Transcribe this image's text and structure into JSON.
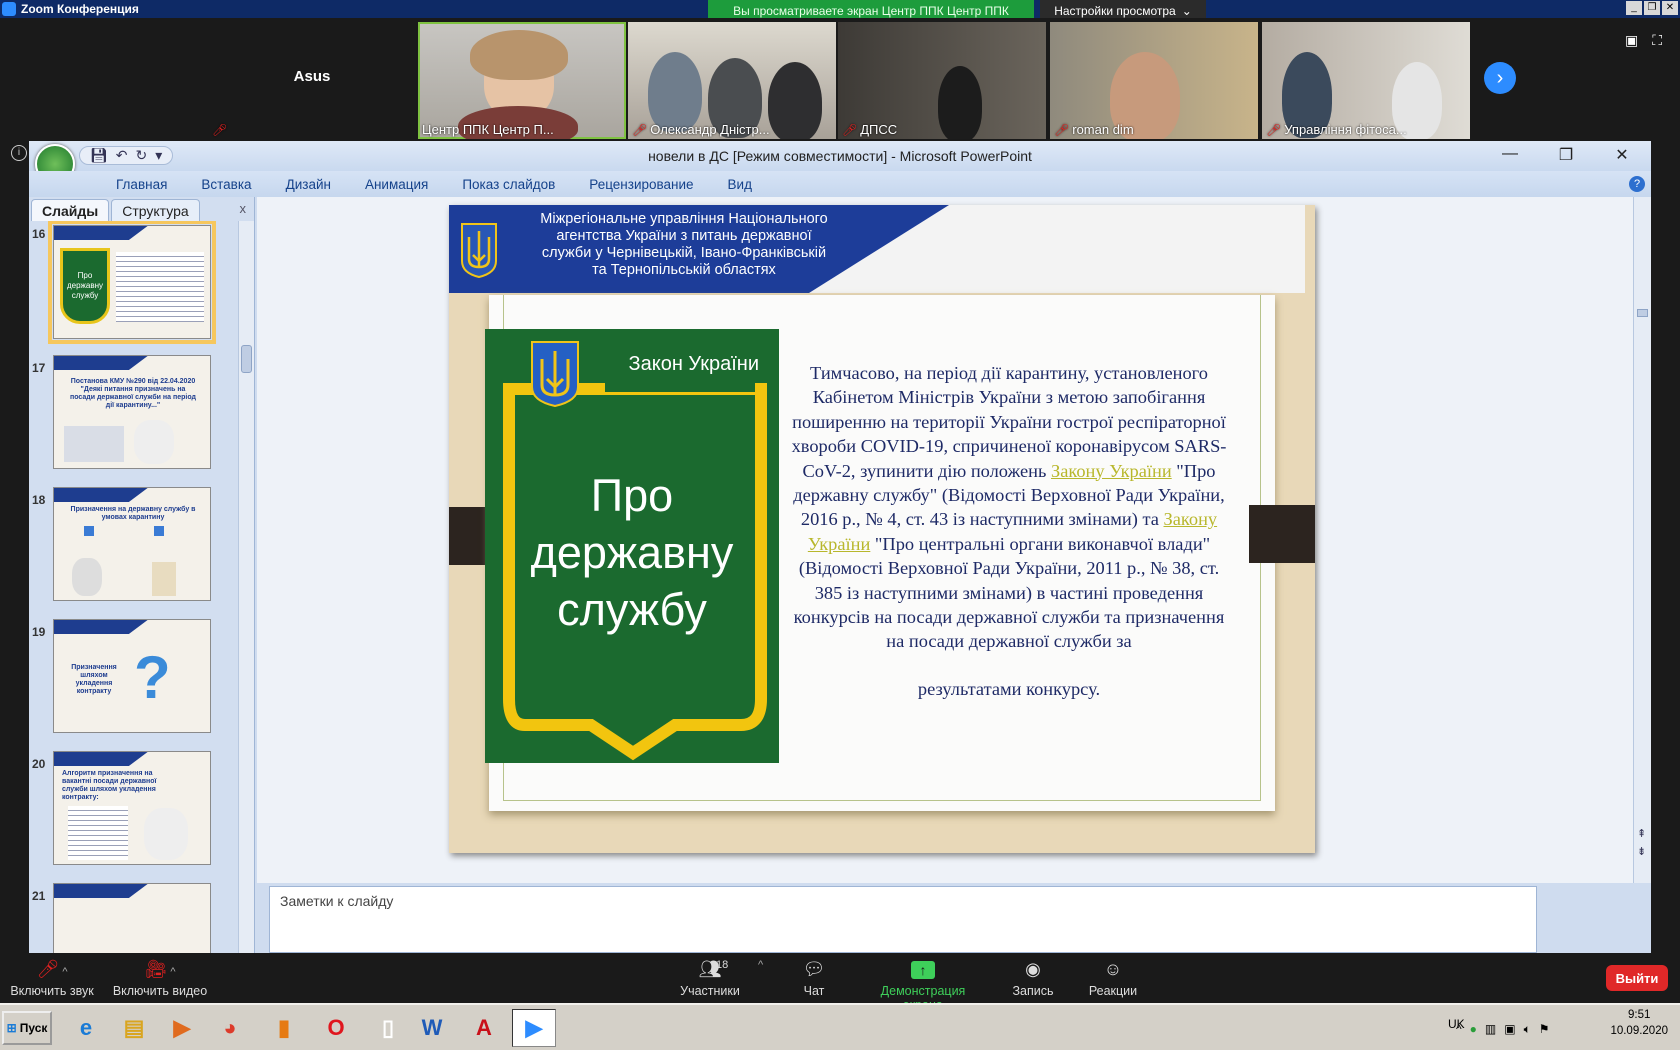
{
  "zoom": {
    "window_title": "Zoom Конференция",
    "share_banner": "Вы просматриваете экран Центр ППК Центр ППК",
    "view_options": "Настройки просмотра",
    "view_options_icon": "chevron-down-icon",
    "participants": [
      {
        "name": "Asus",
        "muted": true,
        "video": false
      },
      {
        "name": "Центр ППК Центр П...",
        "muted": false,
        "video": true
      },
      {
        "name": "Олександр Дністр...",
        "muted": true,
        "video": true
      },
      {
        "name": "ДПСС",
        "muted": true,
        "video": true
      },
      {
        "name": "roman dim",
        "muted": true,
        "video": true
      },
      {
        "name": "Управління фітоса...",
        "muted": true,
        "video": true
      }
    ],
    "toolbar": {
      "mute": "Включить звук",
      "video": "Включить видео",
      "participants": "Участники",
      "participants_count": "18",
      "chat": "Чат",
      "share": "Демонстрация экрана",
      "record": "Запись",
      "reactions": "Реакции",
      "leave": "Выйти"
    },
    "colors": {
      "share_green": "#1d9c3c",
      "leave_red": "#e02828",
      "accent_blue": "#2d8cff"
    }
  },
  "powerpoint": {
    "title": "новели в ДС [Режим совместимости] - Microsoft PowerPoint",
    "ribbon_tabs": [
      "Главная",
      "Вставка",
      "Дизайн",
      "Анимация",
      "Показ слайдов",
      "Рецензирование",
      "Вид"
    ],
    "pane_tabs": [
      "Слайды",
      "Структура"
    ],
    "pane_close": "x",
    "thumbnails": [
      {
        "num": "16",
        "text": "Про державну службу",
        "selected": true
      },
      {
        "num": "17",
        "text": "Постанова КМУ №290 від 22.04.2020 \"Деякі питання призначень на посади державної служби на період дії карантину...\"",
        "selected": false
      },
      {
        "num": "18",
        "text": "Призначення на державну службу в умовах карантину",
        "selected": false
      },
      {
        "num": "19",
        "text": "Призначення шляхом укладення контракту",
        "selected": false
      },
      {
        "num": "20",
        "text": "Алгоритм призначення на вакантні посади державної служби шляхом укладення контракту:",
        "selected": false
      },
      {
        "num": "21",
        "text": "",
        "selected": false
      }
    ],
    "notes_placeholder": "Заметки к слайду",
    "slide": {
      "header": "Міжрегіональне управління Національного агентства України з питань державної служби  у Чернівецькій, Івано-Франківській та Тернопільській областях",
      "law_label": "Закон України",
      "law_title_lines": [
        "Про",
        "державну",
        "службу"
      ],
      "body_parts": {
        "p1": "Тимчасово, на період дії карантину, установленого Кабінетом Міністрів України з метою запобігання поширенню на території України гострої респіраторної хвороби COVID-19, спричиненої коронавірусом SARS-CoV-2, зупинити дію положень ",
        "link1": "Закону України",
        "p2": " \"Про державну службу\" (Відомості Верховної Ради України, 2016 р., № 4, ст. 43 із наступними змінами) та ",
        "link2": "Закону України",
        "p3": " \"Про центральні органи виконавчої влади\" (Відомості Верховної Ради України, 2011 р., № 38, ст. 385 із наступними змінами) в частині проведення конкурсів на посади державної служби та призначення на посади державної служби за",
        "last_line": "результатами конкурсу."
      }
    }
  },
  "taskbar": {
    "start": "Пуск",
    "apps": [
      "ie-icon",
      "explorer-icon",
      "media-icon",
      "chrome-icon",
      "app-icon",
      "opera-icon",
      "notepad-icon",
      "word-icon",
      "acrobat-icon",
      "zoom-icon"
    ],
    "lang": "UK",
    "time": "9:51",
    "date": "10.09.2020"
  }
}
